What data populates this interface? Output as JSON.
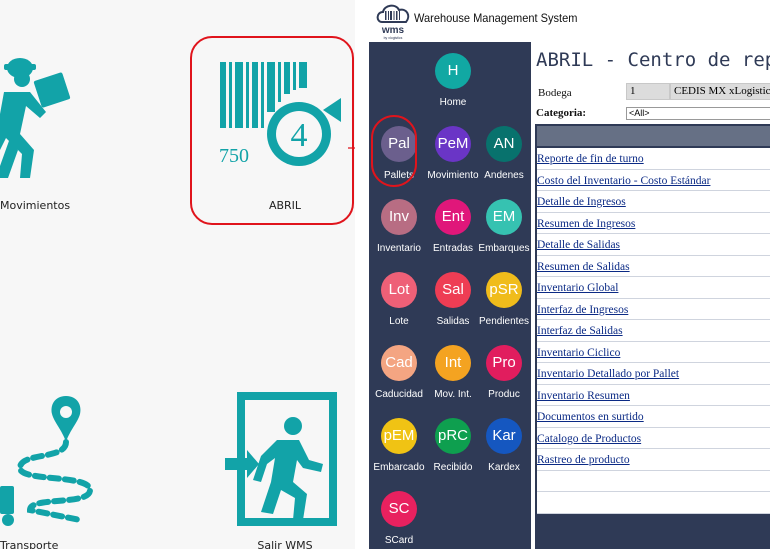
{
  "tiles": [
    {
      "label": "Movimientos"
    },
    {
      "label": "ABRIL"
    },
    {
      "label": "Transporte"
    },
    {
      "label": "Salir WMS"
    }
  ],
  "abril_icon": {
    "number": "750",
    "badge": "4"
  },
  "header": {
    "title": "Warehouse Management System",
    "logo_text": "wms",
    "logo_sub": "by xlogistics"
  },
  "menu": [
    {
      "abbr": "H",
      "label": "Home",
      "color": "#11a8a3"
    },
    {
      "abbr": "Pal",
      "label": "Pallets",
      "color": "#6b5f8d"
    },
    {
      "abbr": "PeM",
      "label": "Movimiento",
      "color": "#6a35c6"
    },
    {
      "abbr": "AN",
      "label": "Andenes",
      "color": "#08726d"
    },
    {
      "abbr": "Inv",
      "label": "Inventario",
      "color": "#b86d83"
    },
    {
      "abbr": "Ent",
      "label": "Entradas",
      "color": "#e0177a"
    },
    {
      "abbr": "EM",
      "label": "Embarques",
      "color": "#36c2b1"
    },
    {
      "abbr": "Lot",
      "label": "Lote",
      "color": "#ee6077"
    },
    {
      "abbr": "Sal",
      "label": "Salidas",
      "color": "#ee3d54"
    },
    {
      "abbr": "pSR",
      "label": "Pendientes",
      "color": "#f0bc1b"
    },
    {
      "abbr": "Cad",
      "label": "Caducidad",
      "color": "#f4a582"
    },
    {
      "abbr": "Int",
      "label": "Mov. Int.",
      "color": "#f4a321"
    },
    {
      "abbr": "Pro",
      "label": "Produc",
      "color": "#e11d5e"
    },
    {
      "abbr": "pEM",
      "label": "Embarcado",
      "color": "#f0c314"
    },
    {
      "abbr": "pRC",
      "label": "Recibido",
      "color": "#0e9f4f"
    },
    {
      "abbr": "Kar",
      "label": "Kardex",
      "color": "#1557c0"
    },
    {
      "abbr": "SC",
      "label": "SCard",
      "color": "#e8215f"
    }
  ],
  "page": {
    "title": "ABRIL - Centro de reportes",
    "bodega_label": "Bodega",
    "bodega_code": "1",
    "bodega_name": "CEDIS MX xLogistics",
    "categoria_label": "Categoria:",
    "categoria_value": "<All>"
  },
  "reports": [
    "Reporte de fin de turno",
    "Costo del Inventario - Costo Estándar",
    "Detalle de Ingresos",
    "Resumen de Ingresos",
    "Detalle de Salidas",
    "Resumen de Salidas",
    "Inventario Global",
    "Interfaz de Ingresos",
    "Interfaz de Salidas",
    "Inventario Ciclico",
    "Inventario Detallado por Pallet",
    "Inventario Resumen",
    "Documentos en surtido",
    "Catalogo de Productos",
    "Rastreo de producto"
  ],
  "colors": {
    "teal": "#12a3a8",
    "navy": "#2f3a56",
    "highlight": "#e0141c",
    "link": "#0b2a85"
  }
}
